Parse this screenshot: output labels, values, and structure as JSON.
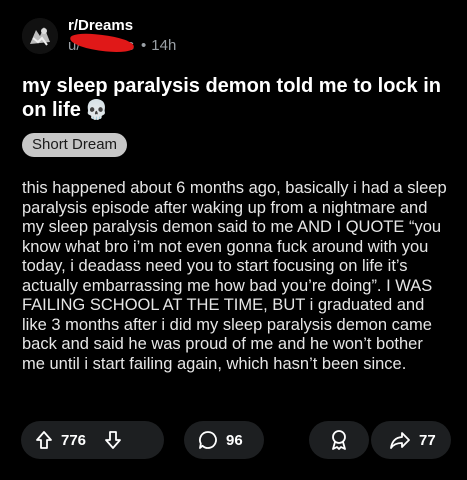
{
  "post": {
    "subreddit": "r/Dreams",
    "username": "u/",
    "username_tail": "s",
    "age": "14h",
    "title": "my sleep paralysis demon told me to lock in on life",
    "title_emoji": "💀",
    "flair": "Short Dream",
    "body": "this happened about 6 months ago, basically i had a sleep paralysis episode after waking up from a nightmare and my sleep paralysis demon said to me AND I QUOTE “you know what bro i’m not even gonna fuck around with you today, i deadass need you to start focusing on life it’s actually embarrassing me how bad you’re doing”. I WAS FAILING SCHOOL AT THE TIME, BUT i graduated and like 3 months after i did my sleep paralysis demon came back and said he was proud of me and he won’t bother me until i start failing again, which hasn’t been since."
  },
  "actions": {
    "upvotes": "776",
    "comments": "96",
    "shares": "77"
  },
  "colors": {
    "background": "#000000",
    "action_pill": "#1d1f21",
    "flair_bg": "#c7c7c7",
    "redaction": "#e01818",
    "muted_text": "#9aa0a6"
  },
  "icons": [
    "subreddit-avatar-icon",
    "skull-emoji",
    "upvote-arrow-icon",
    "downvote-arrow-icon",
    "comment-bubble-icon",
    "award-icon",
    "share-arrow-icon"
  ]
}
